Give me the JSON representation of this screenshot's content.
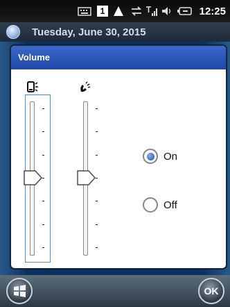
{
  "status_bar": {
    "time": "12:25",
    "icons": [
      "keyboard-icon",
      "notification-1-icon",
      "warning-icon",
      "sync-icon",
      "signal-icon",
      "speaker-icon",
      "battery-icon"
    ],
    "notification_count": "1"
  },
  "today": {
    "date": "Tuesday, June 30, 2015"
  },
  "dialog": {
    "title": "Volume",
    "ringer_column_icon": "device-sound-icon",
    "phone_column_icon": "phone-icon",
    "ringer_level_fraction": 0.5,
    "phone_level_fraction": 0.5,
    "options": [
      {
        "label": "On",
        "selected": true
      },
      {
        "label": "Off",
        "selected": false
      }
    ]
  },
  "softkeys": {
    "left_icon": "windows-start-icon",
    "right_label": "OK"
  },
  "colors": {
    "title_bar": "#1f49a8",
    "slider_focus": "#5b86c9",
    "radio_fill": "#1b4fb0"
  }
}
